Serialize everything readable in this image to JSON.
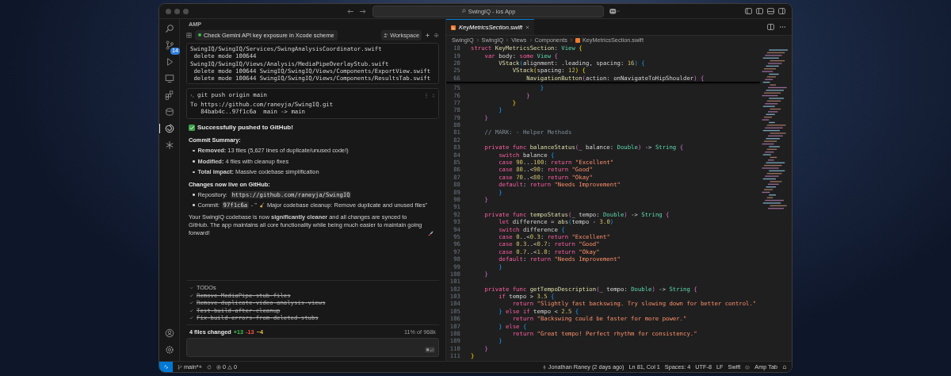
{
  "window": {
    "search": "SwingIQ - ios App"
  },
  "activity_bar": {
    "source_control_badge": "14"
  },
  "amp_panel": {
    "header": "AMP",
    "thread_title": "Check Gemini API key exposure in Xcode scheme",
    "workspace": "Workspace",
    "terminal_output": [
      "SwingIQ/SwingIQ/Services/SwingAnalysisCoordinator.swift",
      " delete mode 100644",
      "SwingIQ/SwingIQ/Views/Analysis/MediaPipeOverlayStub.swift",
      " delete mode 100644 SwingIQ/SwingIQ/Views/Components/ExportView.swift",
      " delete mode 100644 SwingIQ/SwingIQ/Views/Components/ResultsTab.swift"
    ],
    "command": {
      "text": "git push origin main",
      "output": [
        "To https://github.com/raneyja/SwingIQ.git",
        "   84bab4c..97f1c6a  main -> main"
      ]
    },
    "success": "Successfully pushed to GitHub!",
    "summary_heading": "Commit Summary:",
    "summary_items": [
      "**Removed:** 13 files (5,627 lines of duplicate/unused code!)",
      "**Modified:** 4 files with cleanup fixes",
      "**Total impact:** Massive codebase simplification"
    ],
    "changes_heading": "Changes now live on GitHub:",
    "repository": {
      "label": "Repository:",
      "code": "https://github.com/raneyja/SwingIQ"
    },
    "commit": {
      "label": "Commit:",
      "code": "97f1c6a",
      "prefix": "- \"",
      "text": "Major codebase cleanup: Remove duplicate and unused files\""
    },
    "closing": "Your SwingIQ codebase is now **significantly cleaner** and all changes are synced to GitHub. The app maintains all core functionality while being much easier to maintain going forward!",
    "todos": {
      "title": "TODOs",
      "items": [
        {
          "label": "Remove-MediaPipe-stub-files",
          "checked": true
        },
        {
          "label": "Remove-duplicate-video-analysis-views",
          "checked": true
        },
        {
          "label": "Test-build-after-cleanup",
          "checked": true
        },
        {
          "label": "Fix-build-errors-from-deleted-stubs",
          "checked": true
        }
      ]
    },
    "diff": {
      "summary": "4 files changed",
      "added": "+13",
      "removed": "-13",
      "modified": "~4"
    },
    "context": "11% of 968k"
  },
  "editor": {
    "tab": {
      "label": "KeyMetricsSection.swift",
      "selected": true
    },
    "breadcrumb": [
      "SwingIQ",
      "SwingIQ",
      "Views",
      "Components",
      "KeyMetricsSection.swift"
    ],
    "sticky_lines": [
      {
        "n": "18",
        "tokens": [
          {
            "kind": "kw",
            "text": "struct "
          },
          {
            "kind": "fn",
            "text": "KeyMetricsSection"
          },
          {
            "kind": "pl",
            "text": ": "
          },
          {
            "kind": "ty",
            "text": "View"
          },
          {
            "kind": "b1",
            "text": " {"
          }
        ]
      },
      {
        "n": "19",
        "tokens": [
          {
            "kind": "kw",
            "text": "    var "
          },
          {
            "kind": "pl",
            "text": "body: "
          },
          {
            "kind": "kw",
            "text": "some "
          },
          {
            "kind": "ty",
            "text": "View"
          },
          {
            "kind": "b2",
            "text": " {"
          }
        ]
      },
      {
        "n": "20",
        "tokens": [
          {
            "kind": "fn",
            "text": "        VStack"
          },
          {
            "kind": "b3",
            "text": "("
          },
          {
            "kind": "pl",
            "text": "alignment: .leading, spacing: "
          },
          {
            "kind": "num",
            "text": "16"
          },
          {
            "kind": "b3",
            "text": ") {"
          }
        ]
      },
      {
        "n": "25",
        "tokens": [
          {
            "kind": "fn",
            "text": "            VStack"
          },
          {
            "kind": "b1",
            "text": "("
          },
          {
            "kind": "pl",
            "text": "spacing: "
          },
          {
            "kind": "num",
            "text": "12"
          },
          {
            "kind": "b1",
            "text": ") {"
          }
        ]
      },
      {
        "n": "66",
        "tokens": [
          {
            "kind": "fn",
            "text": "                NavigationButton"
          },
          {
            "kind": "b2",
            "text": "("
          },
          {
            "kind": "pl",
            "text": "action: onNavigateToHipShoulder"
          },
          {
            "kind": "b2",
            "text": ") {"
          }
        ]
      }
    ],
    "lines": [
      {
        "n": "75",
        "tokens": [
          {
            "kind": "b3",
            "text": "                    }"
          }
        ]
      },
      {
        "n": "76",
        "tokens": [
          {
            "kind": "b2",
            "text": "                }"
          }
        ]
      },
      {
        "n": "77",
        "tokens": [
          {
            "kind": "b1",
            "text": "            }"
          }
        ]
      },
      {
        "n": "78",
        "tokens": [
          {
            "kind": "b3",
            "text": "        }"
          }
        ]
      },
      {
        "n": "79",
        "tokens": [
          {
            "kind": "b2",
            "text": "    }"
          }
        ]
      },
      {
        "n": "80"
      },
      {
        "n": "81",
        "tokens": [
          {
            "kind": "cm",
            "text": "    // MARK: - Helper Methods"
          }
        ]
      },
      {
        "n": "82"
      },
      {
        "n": "83",
        "tokens": [
          {
            "kind": "kw",
            "text": "    private func "
          },
          {
            "kind": "fn",
            "text": "balanceStatus"
          },
          {
            "kind": "b2",
            "text": "("
          },
          {
            "kind": "pl",
            "text": "_ balance: "
          },
          {
            "kind": "ty",
            "text": "Double"
          },
          {
            "kind": "b2",
            "text": ")"
          },
          {
            "kind": "pl",
            "text": " -> "
          },
          {
            "kind": "ty",
            "text": "String"
          },
          {
            "kind": "b2",
            "text": " {"
          }
        ]
      },
      {
        "n": "84",
        "tokens": [
          {
            "kind": "kw",
            "text": "        switch "
          },
          {
            "kind": "pl",
            "text": "balance "
          },
          {
            "kind": "b3",
            "text": "{"
          }
        ]
      },
      {
        "n": "85",
        "tokens": [
          {
            "kind": "kw",
            "text": "        case "
          },
          {
            "kind": "num",
            "text": "90"
          },
          {
            "kind": "pl",
            "text": "..."
          },
          {
            "kind": "num",
            "text": "100"
          },
          {
            "kind": "pl",
            "text": ": "
          },
          {
            "kind": "kw",
            "text": "return "
          },
          {
            "kind": "str",
            "text": "\"Excellent\""
          }
        ]
      },
      {
        "n": "86",
        "tokens": [
          {
            "kind": "kw",
            "text": "        case "
          },
          {
            "kind": "num",
            "text": "80"
          },
          {
            "kind": "pl",
            "text": "..<"
          },
          {
            "kind": "num",
            "text": "90"
          },
          {
            "kind": "pl",
            "text": ": "
          },
          {
            "kind": "kw",
            "text": "return "
          },
          {
            "kind": "str",
            "text": "\"Good\""
          }
        ]
      },
      {
        "n": "87",
        "tokens": [
          {
            "kind": "kw",
            "text": "        case "
          },
          {
            "kind": "num",
            "text": "70"
          },
          {
            "kind": "pl",
            "text": "..<"
          },
          {
            "kind": "num",
            "text": "80"
          },
          {
            "kind": "pl",
            "text": ": "
          },
          {
            "kind": "kw",
            "text": "return "
          },
          {
            "kind": "str",
            "text": "\"Okay\""
          }
        ]
      },
      {
        "n": "88",
        "tokens": [
          {
            "kind": "kw",
            "text": "        default"
          },
          {
            "kind": "pl",
            "text": ": "
          },
          {
            "kind": "kw",
            "text": "return "
          },
          {
            "kind": "str",
            "text": "\"Needs Improvement\""
          }
        ]
      },
      {
        "n": "89",
        "tokens": [
          {
            "kind": "b3",
            "text": "        }"
          }
        ]
      },
      {
        "n": "90",
        "tokens": [
          {
            "kind": "b2",
            "text": "    }"
          }
        ]
      },
      {
        "n": "91"
      },
      {
        "n": "92",
        "tokens": [
          {
            "kind": "kw",
            "text": "    private func "
          },
          {
            "kind": "fn",
            "text": "tempoStatus"
          },
          {
            "kind": "b2",
            "text": "("
          },
          {
            "kind": "pl",
            "text": "_ tempo: "
          },
          {
            "kind": "ty",
            "text": "Double"
          },
          {
            "kind": "b2",
            "text": ")"
          },
          {
            "kind": "pl",
            "text": " -> "
          },
          {
            "kind": "ty",
            "text": "String"
          },
          {
            "kind": "b2",
            "text": " {"
          }
        ]
      },
      {
        "n": "93",
        "tokens": [
          {
            "kind": "kw",
            "text": "        let "
          },
          {
            "kind": "pl",
            "text": "difference = "
          },
          {
            "kind": "fn",
            "text": "abs"
          },
          {
            "kind": "b3",
            "text": "("
          },
          {
            "kind": "pl",
            "text": "tempo - "
          },
          {
            "kind": "num",
            "text": "3.0"
          },
          {
            "kind": "b3",
            "text": ")"
          }
        ]
      },
      {
        "n": "94",
        "tokens": [
          {
            "kind": "kw",
            "text": "        switch "
          },
          {
            "kind": "pl",
            "text": "difference "
          },
          {
            "kind": "b3",
            "text": "{"
          }
        ]
      },
      {
        "n": "95",
        "tokens": [
          {
            "kind": "kw",
            "text": "        case "
          },
          {
            "kind": "num",
            "text": "0"
          },
          {
            "kind": "pl",
            "text": "..<"
          },
          {
            "kind": "num",
            "text": "0.3"
          },
          {
            "kind": "pl",
            "text": ": "
          },
          {
            "kind": "kw",
            "text": "return "
          },
          {
            "kind": "str",
            "text": "\"Excellent\""
          }
        ]
      },
      {
        "n": "96",
        "tokens": [
          {
            "kind": "kw",
            "text": "        case "
          },
          {
            "kind": "num",
            "text": "0.3"
          },
          {
            "kind": "pl",
            "text": "..<"
          },
          {
            "kind": "num",
            "text": "0.7"
          },
          {
            "kind": "pl",
            "text": ": "
          },
          {
            "kind": "kw",
            "text": "return "
          },
          {
            "kind": "str",
            "text": "\"Good\""
          }
        ]
      },
      {
        "n": "97",
        "tokens": [
          {
            "kind": "kw",
            "text": "        case "
          },
          {
            "kind": "num",
            "text": "0.7"
          },
          {
            "kind": "pl",
            "text": "..<"
          },
          {
            "kind": "num",
            "text": "1.0"
          },
          {
            "kind": "pl",
            "text": ": "
          },
          {
            "kind": "kw",
            "text": "return "
          },
          {
            "kind": "str",
            "text": "\"Okay\""
          }
        ]
      },
      {
        "n": "98",
        "tokens": [
          {
            "kind": "kw",
            "text": "        default"
          },
          {
            "kind": "pl",
            "text": ": "
          },
          {
            "kind": "kw",
            "text": "return "
          },
          {
            "kind": "str",
            "text": "\"Needs Improvement\""
          }
        ]
      },
      {
        "n": "99",
        "tokens": [
          {
            "kind": "b3",
            "text": "        }"
          }
        ]
      },
      {
        "n": "100",
        "tokens": [
          {
            "kind": "b2",
            "text": "    }"
          }
        ]
      },
      {
        "n": "101"
      },
      {
        "n": "102",
        "tokens": [
          {
            "kind": "kw",
            "text": "    private func "
          },
          {
            "kind": "fn",
            "text": "getTempoDescription"
          },
          {
            "kind": "b2",
            "text": "("
          },
          {
            "kind": "pl",
            "text": "_ tempo: "
          },
          {
            "kind": "ty",
            "text": "Double"
          },
          {
            "kind": "b2",
            "text": ")"
          },
          {
            "kind": "pl",
            "text": " -> "
          },
          {
            "kind": "ty",
            "text": "String"
          },
          {
            "kind": "b2",
            "text": " {"
          }
        ]
      },
      {
        "n": "103",
        "tokens": [
          {
            "kind": "kw",
            "text": "        if "
          },
          {
            "kind": "pl",
            "text": "tempo > "
          },
          {
            "kind": "num",
            "text": "3.5"
          },
          {
            "kind": "b3",
            "text": " {"
          }
        ]
      },
      {
        "n": "104",
        "tokens": [
          {
            "kind": "kw",
            "text": "            return "
          },
          {
            "kind": "str",
            "text": "\"Slightly fast backswing. Try slowing down for better control.\""
          }
        ]
      },
      {
        "n": "105",
        "tokens": [
          {
            "kind": "b3",
            "text": "        } "
          },
          {
            "kind": "kw",
            "text": "else if "
          },
          {
            "kind": "pl",
            "text": "tempo < "
          },
          {
            "kind": "num",
            "text": "2.5"
          },
          {
            "kind": "b3",
            "text": " {"
          }
        ]
      },
      {
        "n": "106",
        "tokens": [
          {
            "kind": "kw",
            "text": "            return "
          },
          {
            "kind": "str",
            "text": "\"Backswing could be faster for more power.\""
          }
        ]
      },
      {
        "n": "107",
        "tokens": [
          {
            "kind": "b3",
            "text": "        } "
          },
          {
            "kind": "kw",
            "text": "else "
          },
          {
            "kind": "b3",
            "text": "{"
          }
        ]
      },
      {
        "n": "108",
        "tokens": [
          {
            "kind": "kw",
            "text": "            return "
          },
          {
            "kind": "str",
            "text": "\"Great tempo! Perfect rhythm for consistency.\""
          }
        ]
      },
      {
        "n": "109",
        "tokens": [
          {
            "kind": "b3",
            "text": "        }"
          }
        ]
      },
      {
        "n": "110",
        "tokens": [
          {
            "kind": "b2",
            "text": "    }"
          }
        ]
      },
      {
        "n": "111",
        "tokens": [
          {
            "kind": "b1",
            "text": "}"
          }
        ]
      }
    ]
  },
  "status_bar": {
    "branch": "main*+",
    "errors": "0",
    "warnings": "0",
    "blame": "Jonathan Raney (2 days ago)",
    "position": "Ln 81, Col 1",
    "indent": "Spaces: 4",
    "encoding": "UTF-8",
    "eol": "LF",
    "language": "Swift",
    "amp": "Amp Tab"
  }
}
